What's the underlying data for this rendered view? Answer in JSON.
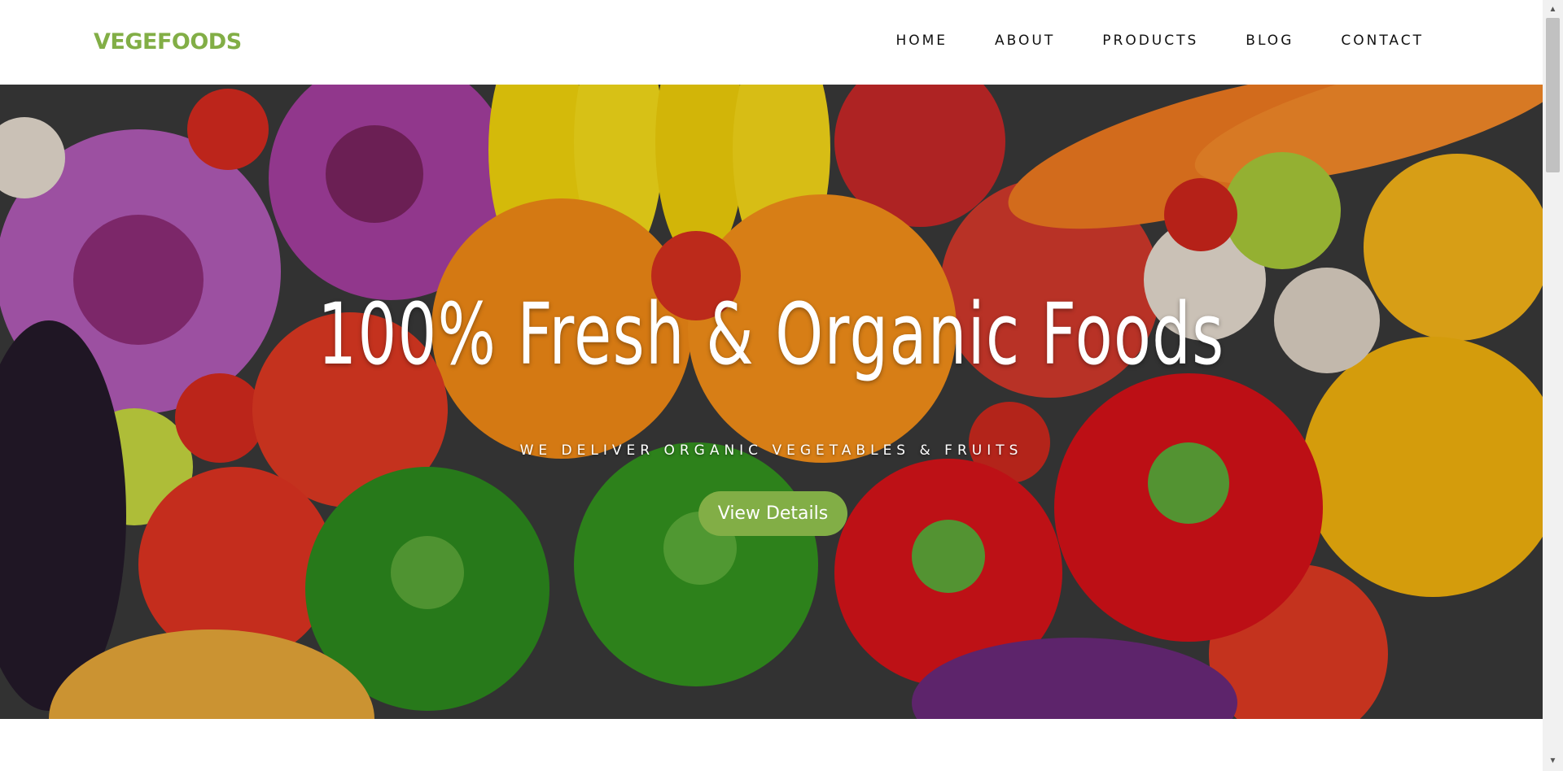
{
  "header": {
    "brand": "VEGEFOODS",
    "nav": [
      {
        "label": "HOME"
      },
      {
        "label": "ABOUT"
      },
      {
        "label": "PRODUCTS"
      },
      {
        "label": "BLOG"
      },
      {
        "label": "CONTACT"
      }
    ]
  },
  "hero": {
    "title": "100% Fresh & Organic Foods",
    "subtitle": "WE DELIVER ORGANIC VEGETABLES & FRUITS",
    "button_label": "View Details"
  },
  "scrollbar": {
    "up_icon": "▲",
    "down_icon": "▼"
  },
  "colors": {
    "brand": "#82ae46",
    "nav_text": "#111111",
    "hero_text": "#ffffff"
  }
}
